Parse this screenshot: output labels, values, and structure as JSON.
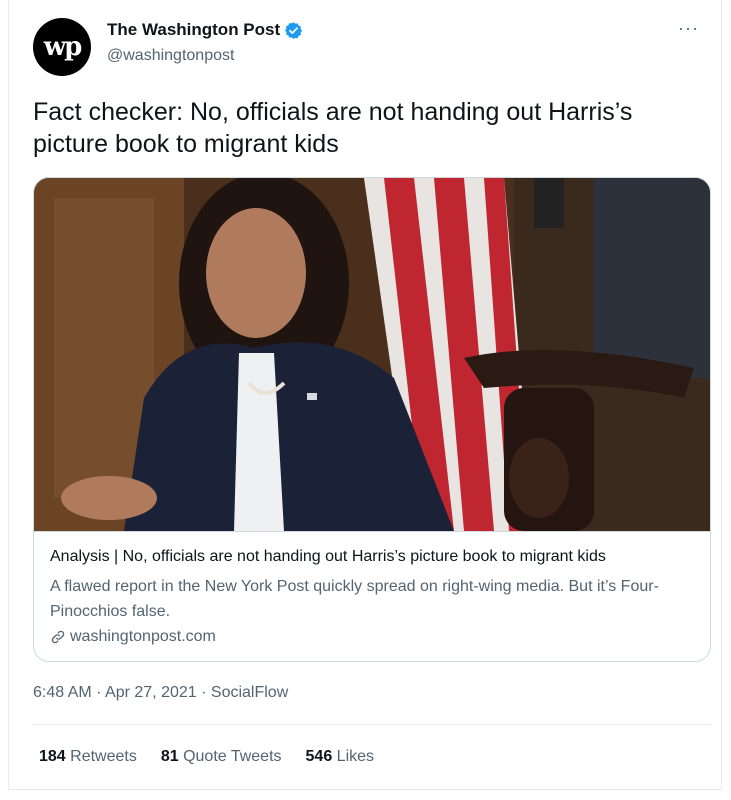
{
  "account": {
    "avatar_text": "wp",
    "display_name": "The Washington Post",
    "handle": "@washingtonpost",
    "verified": true
  },
  "more_label": "···",
  "tweet_text": "Fact checker: No, officials are not handing out Harris’s picture book to migrant kids",
  "card": {
    "title": "Analysis | No, officials are not handing out Harris’s picture book to migrant kids",
    "description": "A flawed report in the New York Post quickly spread on right-wing media. But it’s Four-Pinocchios false.",
    "domain": "washingtonpost.com"
  },
  "meta": {
    "time": "6:48 AM",
    "sep1": " · ",
    "date": "Apr 27, 2021",
    "sep2": " · ",
    "source": "SocialFlow"
  },
  "stats": {
    "retweets_count": "184",
    "retweets_label": " Retweets",
    "quotes_count": "81",
    "quotes_label": " Quote Tweets",
    "likes_count": "546",
    "likes_label": " Likes"
  },
  "colors": {
    "verified_blue": "#1d9bf0",
    "secondary_text": "#536471",
    "border": "#cfd9de"
  }
}
